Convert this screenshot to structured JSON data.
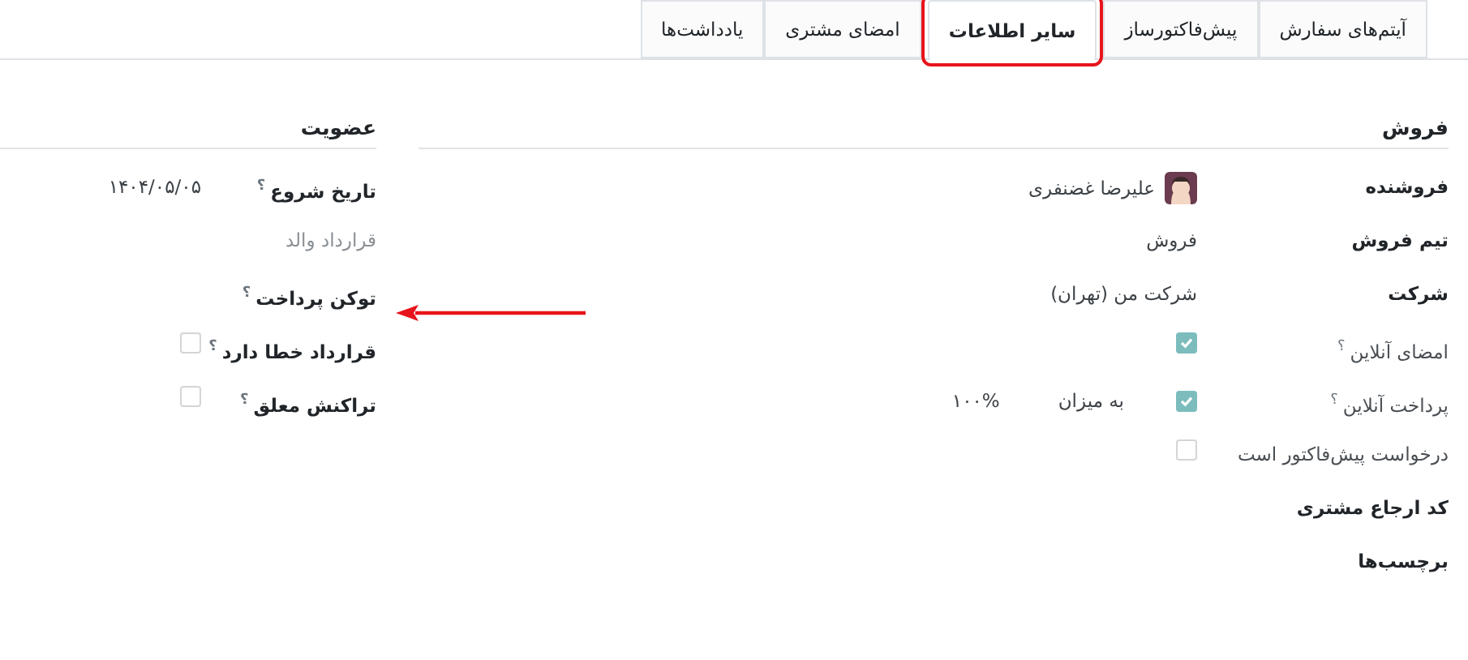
{
  "tabs": [
    {
      "label": "آیتم‌های سفارش",
      "selected": false,
      "highlighted": false
    },
    {
      "label": "پیش‌فاکتورساز",
      "selected": false,
      "highlighted": false
    },
    {
      "label": "سایر اطلاعات",
      "selected": true,
      "highlighted": true
    },
    {
      "label": "امضای مشتری",
      "selected": false,
      "highlighted": false
    },
    {
      "label": "یادداشت‌ها",
      "selected": false,
      "highlighted": false
    }
  ],
  "sections": [
    {
      "title": "فروش",
      "fields": [
        {
          "label": "فروشنده",
          "bold": true,
          "kind": "avatar_text",
          "value": "علیرضا غضنفری"
        },
        {
          "label": "تیم فروش",
          "bold": true,
          "kind": "text",
          "value": "فروش"
        },
        {
          "label": "شرکت",
          "bold": true,
          "kind": "text",
          "value": "شرکت من (تهران)"
        },
        {
          "label": "امضای آنلاین",
          "help": "؟",
          "bold": false,
          "kind": "checkbox",
          "checked": true
        },
        {
          "label": "پرداخت آنلاین",
          "help": "؟",
          "bold": false,
          "kind": "checkbox_rate",
          "checked": true,
          "rate_label": "به میزان",
          "rate_value": "۱۰۰%"
        },
        {
          "label": "درخواست پیش‌فاکتور است",
          "bold": false,
          "kind": "checkbox",
          "checked": false
        },
        {
          "label": "کد ارجاع مشتری",
          "bold": true,
          "kind": "empty"
        },
        {
          "label": "برچسب‌ها",
          "bold": true,
          "kind": "empty"
        }
      ]
    },
    {
      "title": "عضویت",
      "fields": [
        {
          "label": "تاریخ شروع",
          "help": "؟",
          "bold": true,
          "kind": "text",
          "value": "۱۴۰۴/۰۵/۰۵"
        },
        {
          "label": "قرارداد والد",
          "bold": false,
          "muted": true,
          "kind": "empty"
        },
        {
          "label": "توکن پرداخت",
          "help": "؟",
          "bold": true,
          "kind": "empty"
        },
        {
          "label": "قرارداد خطا دارد",
          "help": "؟",
          "bold": true,
          "kind": "checkbox",
          "checked": false
        },
        {
          "label": "تراکنش معلق",
          "help": "؟",
          "bold": true,
          "kind": "checkbox",
          "checked": false
        }
      ]
    }
  ]
}
